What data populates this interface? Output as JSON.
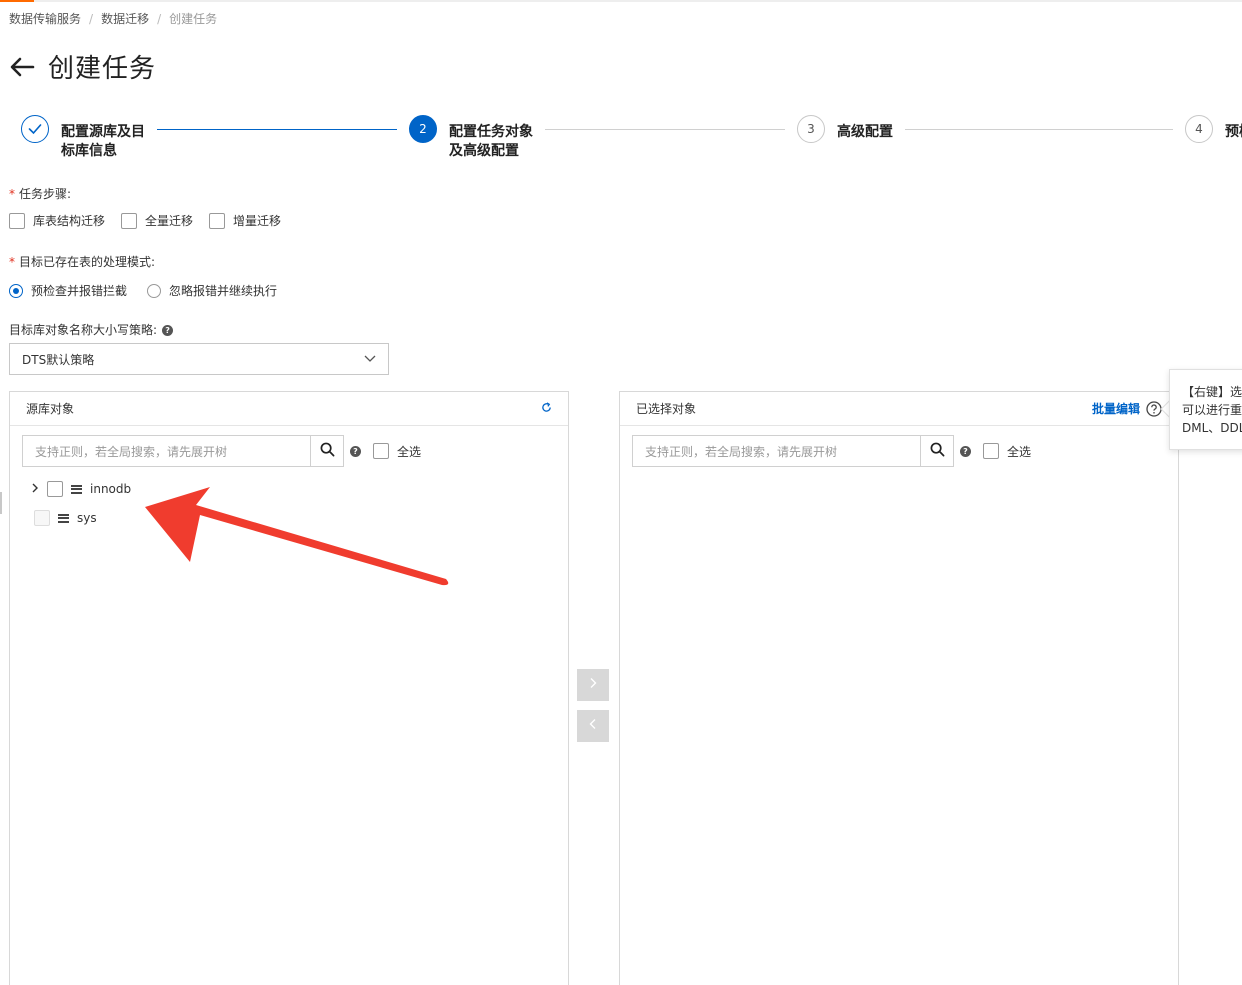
{
  "breadcrumb": [
    "数据传输服务",
    "数据迁移",
    "创建任务"
  ],
  "page_title": "创建任务",
  "steps": [
    {
      "label_line1": "配置源库及目",
      "label_line2": "标库信息",
      "state": "done"
    },
    {
      "number": "2",
      "label_line1": "配置任务对象",
      "label_line2": "及高级配置",
      "state": "active"
    },
    {
      "number": "3",
      "label_line1": "高级配置",
      "state": "pending"
    },
    {
      "number": "4",
      "label_line1": "预检",
      "state": "pending"
    }
  ],
  "task_steps": {
    "label": "任务步骤:",
    "options": [
      "库表结构迁移",
      "全量迁移",
      "增量迁移"
    ]
  },
  "existing_table_mode": {
    "label": "目标已存在表的处理模式:",
    "options": [
      "预检查并报错拦截",
      "忽略报错并继续执行"
    ],
    "selected_index": 0
  },
  "case_policy": {
    "label": "目标库对象名称大小写策略:",
    "value": "DTS默认策略"
  },
  "source_panel": {
    "title": "源库对象",
    "search_placeholder": "支持正则，若全局搜索，请先展开树",
    "select_all": "全选",
    "tree": [
      "innodb",
      "sys"
    ]
  },
  "selected_panel": {
    "title": "已选择对象",
    "batch_edit": "批量编辑",
    "search_placeholder": "支持正则，若全局搜索，请先展开树",
    "select_all": "全选"
  },
  "tooltip": {
    "line1": "【右键】选",
    "line2": "可以进行重",
    "line3": "DML、DDL"
  },
  "colors": {
    "primary": "#0064c8",
    "annotation_arrow": "#f03c2e",
    "required": "#e0301e"
  }
}
